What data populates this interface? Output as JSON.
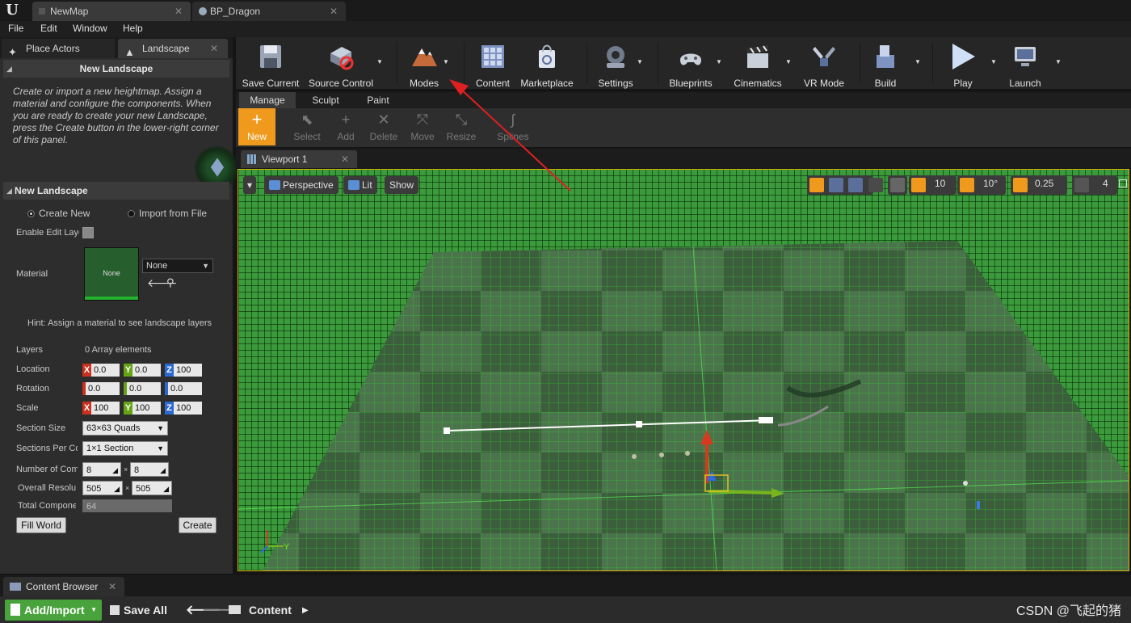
{
  "titlebar": {
    "tabs": [
      {
        "label": "NewMap"
      },
      {
        "label": "BP_Dragon"
      }
    ],
    "logo": "U"
  },
  "menu": [
    "File",
    "Edit",
    "Window",
    "Help"
  ],
  "left_panel": {
    "tabs": [
      {
        "label": "Place Actors"
      },
      {
        "label": "Landscape"
      }
    ],
    "section_title": "New Landscape",
    "description": "Create or import a new heightmap.  Assign a material and configure the components. When you are ready to create your new Landscape, press the Create button in the lower-right corner of this panel.",
    "new_landscape": {
      "header": "New Landscape",
      "create_new": "Create New",
      "import_from_file": "Import from File",
      "enable_edit_layers": "Enable Edit Layers",
      "material_label": "Material",
      "material_thumb": "None",
      "material_value": "None",
      "hint": "Hint: Assign a material to see landscape layers",
      "layers_label": "Layers",
      "layers_value": "0 Array elements",
      "location_label": "Location",
      "location": {
        "x": "0.0",
        "y": "0.0",
        "z": "100"
      },
      "rotation_label": "Rotation",
      "rotation": {
        "x": "0.0",
        "y": "0.0",
        "z": "0.0"
      },
      "scale_label": "Scale",
      "scale": {
        "x": "100",
        "y": "100",
        "z": "100"
      },
      "section_size_label": "Section Size",
      "section_size": "63×63 Quads",
      "sections_per_component_label": "Sections Per Component",
      "sections_per_component": "1×1 Section",
      "number_of_components_label": "Number of Components",
      "components_x": "8",
      "components_y": "8",
      "overall_resolution_label": "Overall Resolution",
      "resolution_x": "505",
      "resolution_y": "505",
      "total_components_label": "Total Components",
      "total_components": "64",
      "fill_world": "Fill World",
      "create": "Create"
    }
  },
  "toolbar": {
    "items": [
      {
        "label": "Save Current"
      },
      {
        "label": "Source Control"
      },
      {
        "label": "Modes"
      },
      {
        "label": "Content"
      },
      {
        "label": "Marketplace"
      },
      {
        "label": "Settings"
      },
      {
        "label": "Blueprints"
      },
      {
        "label": "Cinematics"
      },
      {
        "label": "VR Mode"
      },
      {
        "label": "Build"
      },
      {
        "label": "Play"
      },
      {
        "label": "Launch"
      }
    ]
  },
  "mode_tabs": [
    {
      "label": "Manage"
    },
    {
      "label": "Sculpt"
    },
    {
      "label": "Paint"
    }
  ],
  "tools": [
    {
      "label": "New"
    },
    {
      "label": "Select"
    },
    {
      "label": "Add"
    },
    {
      "label": "Delete"
    },
    {
      "label": "Move"
    },
    {
      "label": "Resize"
    },
    {
      "label": "Splines"
    }
  ],
  "viewport": {
    "tab": "Viewport 1",
    "perspective": "Perspective",
    "lit": "Lit",
    "show": "Show",
    "grid_snap": "10",
    "rot_snap": "10°",
    "scale_snap": "0.25",
    "camera_speed": "4",
    "axis_y": "Y"
  },
  "content_browser": {
    "tab": "Content Browser",
    "add_import": "Add/Import",
    "save_all": "Save All",
    "path": "Content"
  },
  "watermark": "CSDN @飞起的猪",
  "colors": {
    "accent_orange": "#f09a1d",
    "add_green": "#49a33d",
    "annotation_red": "#e02020"
  }
}
